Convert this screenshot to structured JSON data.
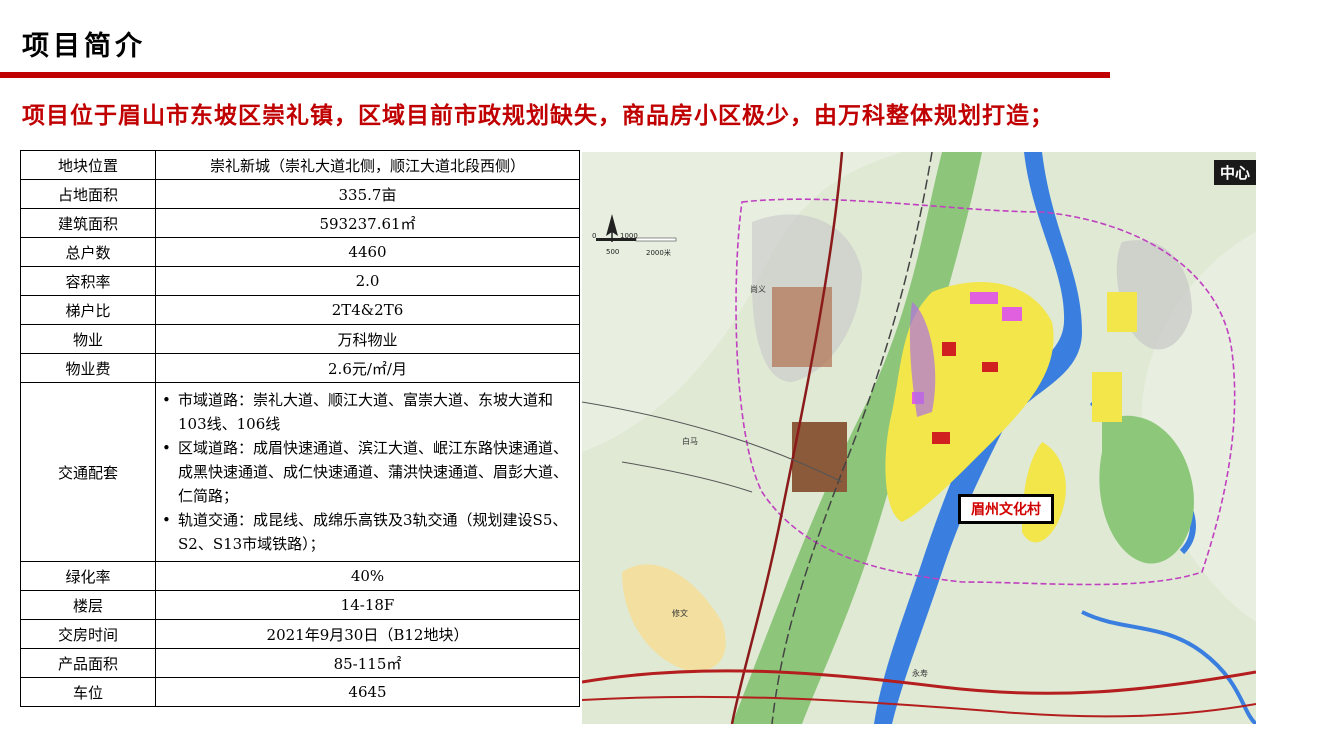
{
  "page": {
    "title": "项目简介",
    "headline": "项目位于眉山市东坡区崇礼镇，区域目前市政规划缺失，商品房小区极少，由万科整体规划打造；"
  },
  "table": {
    "rows": [
      {
        "label": "地块位置",
        "value": "崇礼新城（崇礼大道北侧，顺江大道北段西侧）"
      },
      {
        "label": "占地面积",
        "value": "335.7亩"
      },
      {
        "label": "建筑面积",
        "value": "593237.61㎡"
      },
      {
        "label": "总户数",
        "value": "4460"
      },
      {
        "label": "容积率",
        "value": "2.0"
      },
      {
        "label": "梯户比",
        "value": "2T4&2T6"
      },
      {
        "label": "物业",
        "value": "万科物业"
      },
      {
        "label": "物业费",
        "value": "2.6元/㎡/月"
      }
    ],
    "transport": {
      "label": "交通配套",
      "items": [
        "市域道路：崇礼大道、顺江大道、富崇大道、东坡大道和103线、106线",
        "区域道路：成眉快速通道、滨江大道、岷江东路快速通道、成黑快速通道、成仁快速通道、蒲洪快速通道、眉彭大道、仁简路；",
        "轨道交通：成昆线、成绵乐高铁及3轨交通（规划建设S5、S2、S13市域铁路）；"
      ]
    },
    "rows_after": [
      {
        "label": "绿化率",
        "value": "40%"
      },
      {
        "label": "楼层",
        "value": "14-18F"
      },
      {
        "label": "交房时间",
        "value": "2021年9月30日（B12地块）"
      },
      {
        "label": "产品面积",
        "value": "85-115㎡"
      },
      {
        "label": "车位",
        "value": "4645"
      }
    ]
  },
  "map": {
    "corner_label": "中心",
    "callout": "眉州文化村",
    "scale": {
      "a": "0",
      "b": "1000",
      "c": "500",
      "d": "2000米"
    },
    "places": [
      "尚义",
      "白马",
      "修文",
      "永寿"
    ],
    "colors": {
      "river": "#3a7fe0",
      "green": "#8cc77a",
      "yellow": "#f2e64a",
      "rail": "#8b1a1a",
      "ring": "#c040c0"
    }
  }
}
